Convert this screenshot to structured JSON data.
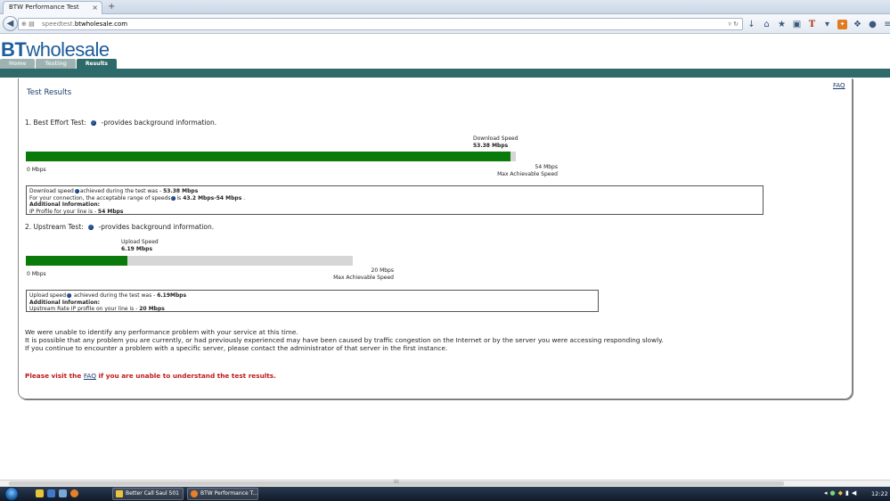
{
  "browser": {
    "tab_title": "BTW Performance Test",
    "tab_close": "×",
    "new_tab": "+",
    "url_prefix": "speedtest.",
    "url_host": "btwholesale.com",
    "back": "◀"
  },
  "site": {
    "logo_bt": "BT",
    "logo_rest": "wholesale",
    "nav": [
      {
        "label": "Home"
      },
      {
        "label": "Testing"
      },
      {
        "label": "Results"
      }
    ],
    "faq_top": "FAQ"
  },
  "results": {
    "title": "Test Results",
    "download": {
      "heading_prefix": "1. Best Effort Test:",
      "heading_suffix": "-provides background information.",
      "speed_label": "Download Speed",
      "speed_value": "53.38 Mbps",
      "fraction": 0.9885,
      "min_label": "0 Mbps",
      "max_value": "54 Mbps",
      "max_label": "Max Achievable Speed",
      "line1_a": "Download speed",
      "line1_b": "achieved during the test was - ",
      "line1_val": "53.38 Mbps",
      "line2_a": "For your connection, the acceptable range of speeds",
      "line2_b": "is ",
      "line2_val": "43.2 Mbps-54 Mbps",
      "line2_end": " .",
      "line3": "Additional Information:",
      "line4_a": "IP Profile for your line is - ",
      "line4_val": "54 Mbps"
    },
    "upload": {
      "heading_prefix": "2. Upstream Test:",
      "heading_suffix": "-provides background information.",
      "speed_label": "Upload Speed",
      "speed_value": "6.19 Mbps",
      "fraction": 0.3095,
      "min_label": "0 Mbps",
      "max_value": "20 Mbps",
      "max_label": "Max Achievable Speed",
      "line1_a": "Upload speed",
      "line1_b": " achieved during the test was - ",
      "line1_val": "6.19Mbps",
      "line3": "Additional Information:",
      "line4_a": "Upstream Rate IP profile on your line is - ",
      "line4_val": "20 Mbps"
    },
    "message": [
      "We were unable to identify any performance problem with your service at this time.",
      "It is possible that any problem you are currently, or had previously experienced may have been caused by traffic congestion on the Internet or by the server you were accessing responding slowly.",
      "If you continue to encounter a problem with a specific server, please contact the administrator of that server in the first instance."
    ],
    "warn_a": "Please visit the ",
    "warn_link": "FAQ",
    "warn_b": " if you are unable to understand the test results."
  },
  "taskbar": {
    "task1": "Better Call Saul 501",
    "task2": "BTW Performance T...",
    "clock": "12:22"
  },
  "colors": {
    "bar_fill": "#0a7a0a",
    "bar_track": "#d6d6d6",
    "brand_teal": "#2f6a6a",
    "warn_red": "#c01818"
  }
}
